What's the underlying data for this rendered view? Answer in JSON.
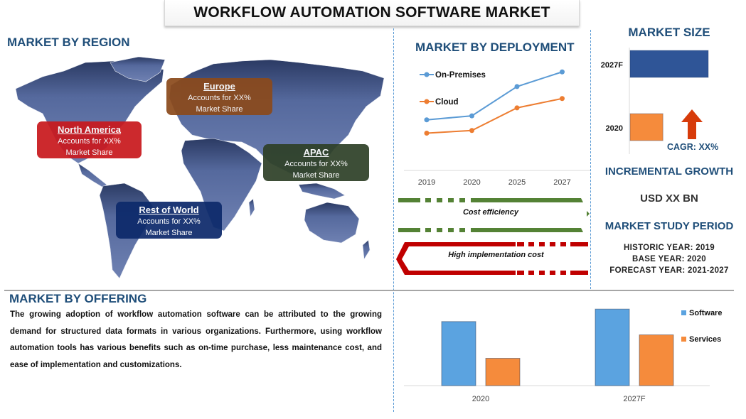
{
  "page_title": "WORKFLOW AUTOMATION SOFTWARE MARKET",
  "region": {
    "title": "MARKET BY REGION",
    "boxes": [
      {
        "name": "North America",
        "line1": "Accounts for XX%",
        "line2": "Market Share",
        "color": "#c9191e"
      },
      {
        "name": "Europe",
        "line1": "Accounts for XX%",
        "line2": "Market Share",
        "color": "#8b4a1c"
      },
      {
        "name": "APAC",
        "line1": "Accounts for XX%",
        "line2": "Market Share",
        "color": "#2f4128"
      },
      {
        "name": "Rest of World",
        "line1": "Accounts for XX%",
        "line2": "Market Share",
        "color": "#0d2a6b"
      }
    ]
  },
  "deployment": {
    "title": "MARKET BY DEPLOYMENT",
    "drivers": {
      "positive": "Cost efficiency",
      "negative": "High implementation cost",
      "positive_color": "#548235",
      "negative_color": "#c00000"
    }
  },
  "market_size": {
    "title": "MARKET SIZE",
    "cagr": "CAGR: XX%"
  },
  "incremental": {
    "title": "INCREMENTAL GROWTH",
    "value": "USD XX BN"
  },
  "study_period": {
    "title": "MARKET STUDY PERIOD",
    "historic": "HISTORIC YEAR: 2019",
    "base": "BASE YEAR: 2020",
    "forecast": "FORECAST YEAR: 2021-2027"
  },
  "offering": {
    "title": "MARKET BY OFFERING",
    "description": "The growing adoption of workflow automation software can be attributed to the growing demand for structured data formats in various organizations. Furthermore, using workflow automation tools has various benefits such as on-time purchase, less maintenance cost, and ease of implementation and customizations."
  },
  "chart_data": [
    {
      "type": "line",
      "title": "MARKET BY DEPLOYMENT",
      "x": [
        "2019",
        "2020",
        "2025",
        "2027"
      ],
      "series": [
        {
          "name": "On-Premises",
          "values": [
            38,
            41,
            63,
            74
          ],
          "color": "#5b9bd5"
        },
        {
          "name": "Cloud",
          "values": [
            28,
            30,
            47,
            54
          ],
          "color": "#ed7d31"
        }
      ],
      "ylim": [
        0,
        80
      ],
      "grid": false,
      "legend": "top-left"
    },
    {
      "type": "bar",
      "orientation": "horizontal",
      "title": "MARKET SIZE",
      "categories": [
        "2027F",
        "2020"
      ],
      "values": [
        100,
        42
      ],
      "colors": [
        "#2f5597",
        "#f58b3c"
      ],
      "xlim": [
        0,
        100
      ]
    },
    {
      "type": "bar",
      "title": "MARKET BY OFFERING",
      "categories": [
        "2020",
        "2027F"
      ],
      "series": [
        {
          "name": "Software",
          "values": [
            82,
            98
          ],
          "color": "#5ba3e0"
        },
        {
          "name": "Services",
          "values": [
            35,
            65
          ],
          "color": "#f58b3c"
        }
      ],
      "ylim": [
        0,
        100
      ],
      "legend": "right"
    }
  ]
}
